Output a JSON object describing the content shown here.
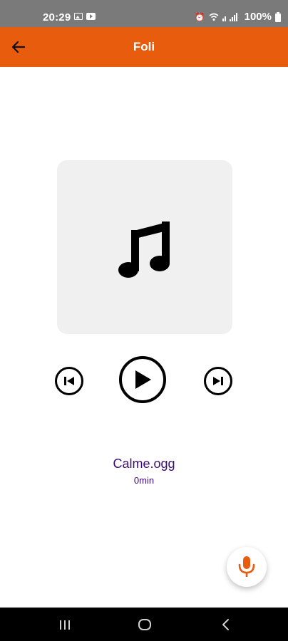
{
  "status_bar": {
    "time": "20:29",
    "battery": "100%",
    "icons": [
      "image-icon",
      "youtube-icon",
      "alarm-icon",
      "wifi-icon",
      "signal-icon",
      "battery-icon"
    ]
  },
  "app_bar": {
    "title": "Foli",
    "back_icon": "arrow-left-icon",
    "background": "#e85c0d"
  },
  "player": {
    "artwork_icon": "music-note-icon",
    "controls": [
      "skip-previous-icon",
      "play-icon",
      "skip-next-icon"
    ],
    "track_title": "Calme.ogg",
    "track_duration": "0min",
    "text_color": "#3b0a78"
  },
  "fab": {
    "icon": "microphone-icon",
    "icon_color": "#e85c0d"
  },
  "nav_bar": {
    "buttons": [
      "recents-icon",
      "home-icon",
      "back-icon"
    ]
  }
}
